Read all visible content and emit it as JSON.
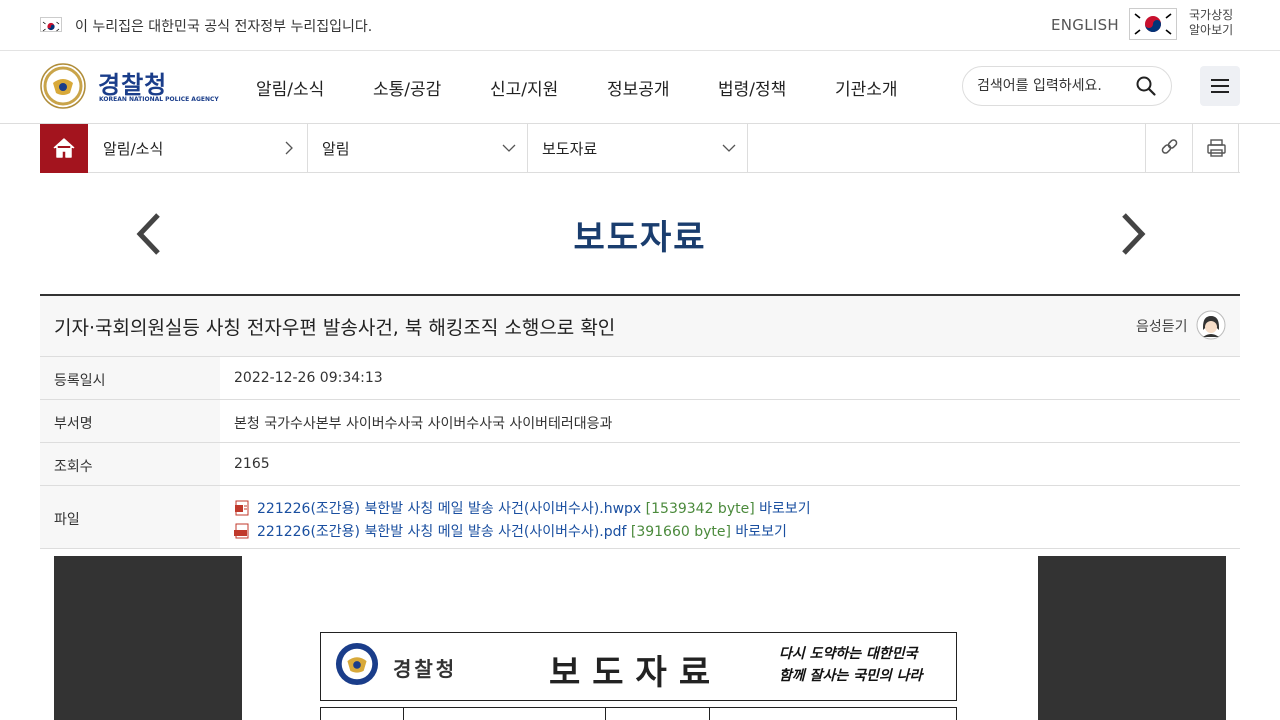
{
  "topbar": {
    "notice": "이 누리집은 대한민국 공식 전자정부 누리집입니다.",
    "english": "ENGLISH",
    "national_symbol": "국가상징 알아보기"
  },
  "header": {
    "logo_name": "경찰청",
    "logo_sub": "KOREAN NATIONAL POLICE AGENCY",
    "gnb": [
      "알림/소식",
      "소통/공감",
      "신고/지원",
      "정보공개",
      "법령/정책",
      "기관소개"
    ],
    "search_placeholder": "검색어를 입력하세요."
  },
  "breadcrumb": {
    "level1": "알림/소식",
    "level2": "알림",
    "level3": "보도자료"
  },
  "page": {
    "title": "보도자료"
  },
  "article": {
    "subject": "기자·국회의원실등 사칭 전자우편 발송사건, 북 해킹조직 소행으로 확인",
    "listen": "음성듣기",
    "fields": {
      "date_label": "등록일시",
      "date_value": "2022-12-26 09:34:13",
      "dept_label": "부서명",
      "dept_value": "본청 국가수사본부 사이버수사국 사이버수사국 사이버테러대응과",
      "views_label": "조회수",
      "views_value": "2165",
      "file_label": "파일"
    },
    "files": [
      {
        "name": "221226(조간용) 북한발 사칭 메일 발송 사건(사이버수사).hwpx",
        "size": "[1539342 byte]",
        "view": "바로보기"
      },
      {
        "name": "221226(조간용) 북한발 사칭 메일 발송 사건(사이버수사).pdf",
        "size": "[391660 byte]",
        "view": "바로보기"
      }
    ]
  },
  "preview": {
    "org": "경찰청",
    "title": "보도자료",
    "slogan_line1": "다시 도약하는 대한민국",
    "slogan_line2": "함께 잘사는 국민의 나라"
  },
  "colors": {
    "brand_navy": "#1a3d8a",
    "home_red": "#a3141e",
    "title_navy": "#1a3d6e",
    "link_blue": "#1a4fa0",
    "size_green": "#4b8a3c"
  }
}
